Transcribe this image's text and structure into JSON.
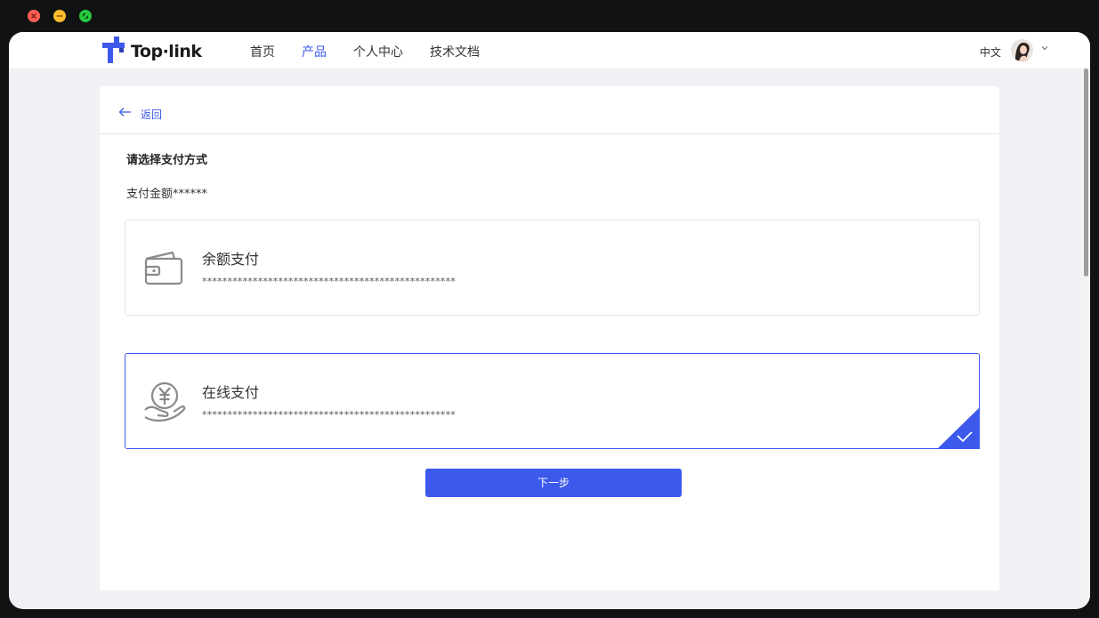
{
  "window": {
    "controls": [
      {
        "name": "close",
        "color": "#fe5f57"
      },
      {
        "name": "minimize",
        "color": "#febc2e"
      },
      {
        "name": "maximize",
        "color": "#28c840"
      }
    ]
  },
  "header": {
    "logo_text": "Top·link",
    "brand_color": "#3c59ec",
    "nav": [
      {
        "label": "首页",
        "active": false
      },
      {
        "label": "产品",
        "active": true
      },
      {
        "label": "个人中心",
        "active": false
      },
      {
        "label": "技术文档",
        "active": false
      }
    ],
    "language": "中文"
  },
  "page": {
    "back_label": "返回",
    "section_title": "请选择支付方式",
    "amount_label": "支付金额******",
    "options": [
      {
        "name": "余额支付",
        "desc": "**************************************************",
        "icon": "wallet-icon",
        "selected": false
      },
      {
        "name": "在线支付",
        "desc": "**************************************************",
        "icon": "yuan-coin-hand-icon",
        "selected": true
      }
    ],
    "next_button": "下一步"
  }
}
